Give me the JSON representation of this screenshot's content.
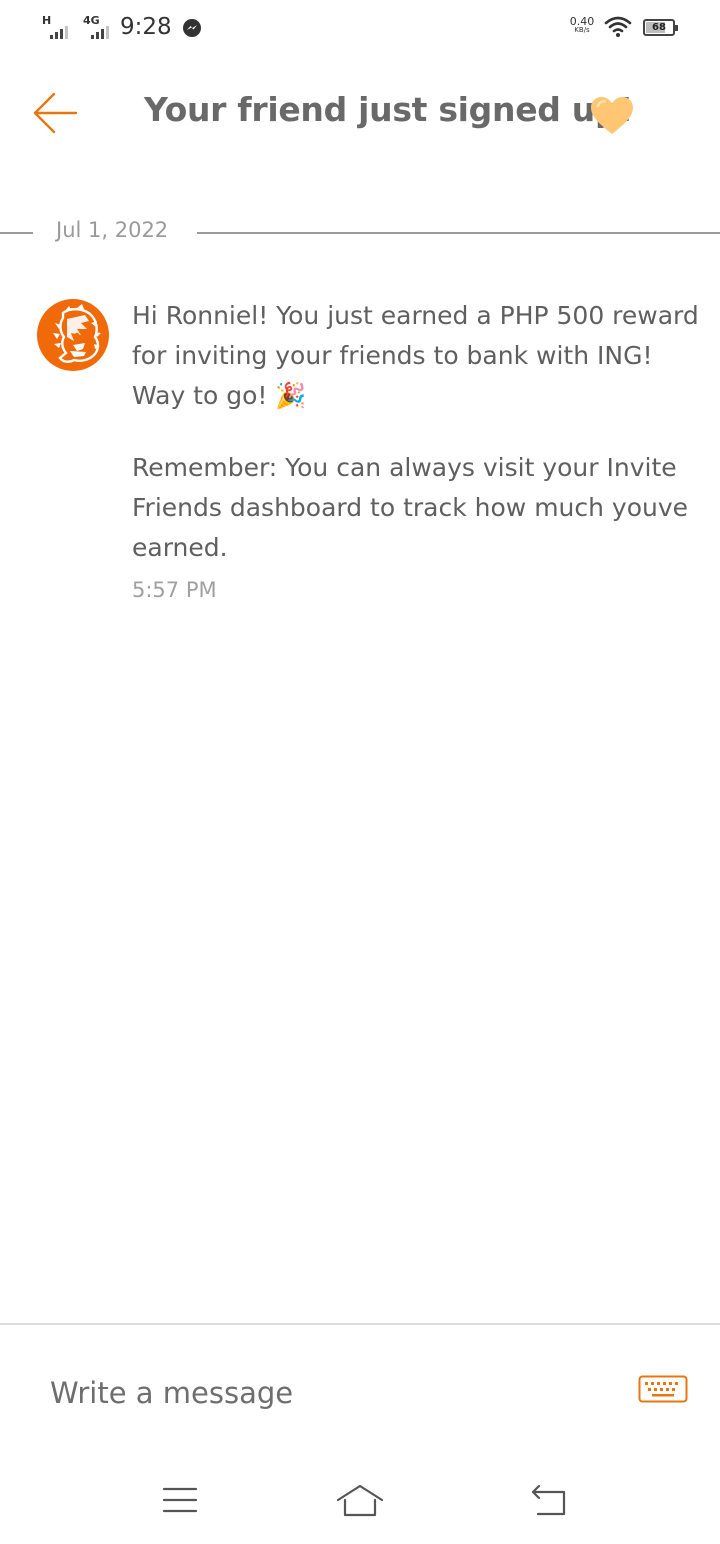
{
  "status_bar": {
    "signal_1_label": "H",
    "signal_2_label": "4G",
    "time": "9:28",
    "net_speed_value": "0.40",
    "net_speed_unit": "KB/s",
    "battery_level": "68"
  },
  "header": {
    "title": "Your friend just signed up!",
    "title_emoji": "heart-icon",
    "accent_color": "#e9750f"
  },
  "conversation": {
    "date": "Jul 1, 2022",
    "message": {
      "avatar": "ing-lion-logo",
      "paragraph_1": "Hi Ronniel! You just earned a PHP 500 reward for inviting your friends to bank with ING! Way to go! 🎉",
      "paragraph_2": "Remember: You can always visit your Invite Friends dashboard to track how much youve earned.",
      "time": "5:57 PM"
    }
  },
  "composer": {
    "placeholder": "Write a message",
    "keyboard_icon": "keyboard-icon"
  },
  "nav_bar": {
    "menu_icon": "menu-icon",
    "home_icon": "home-icon",
    "back_icon": "back-icon"
  }
}
